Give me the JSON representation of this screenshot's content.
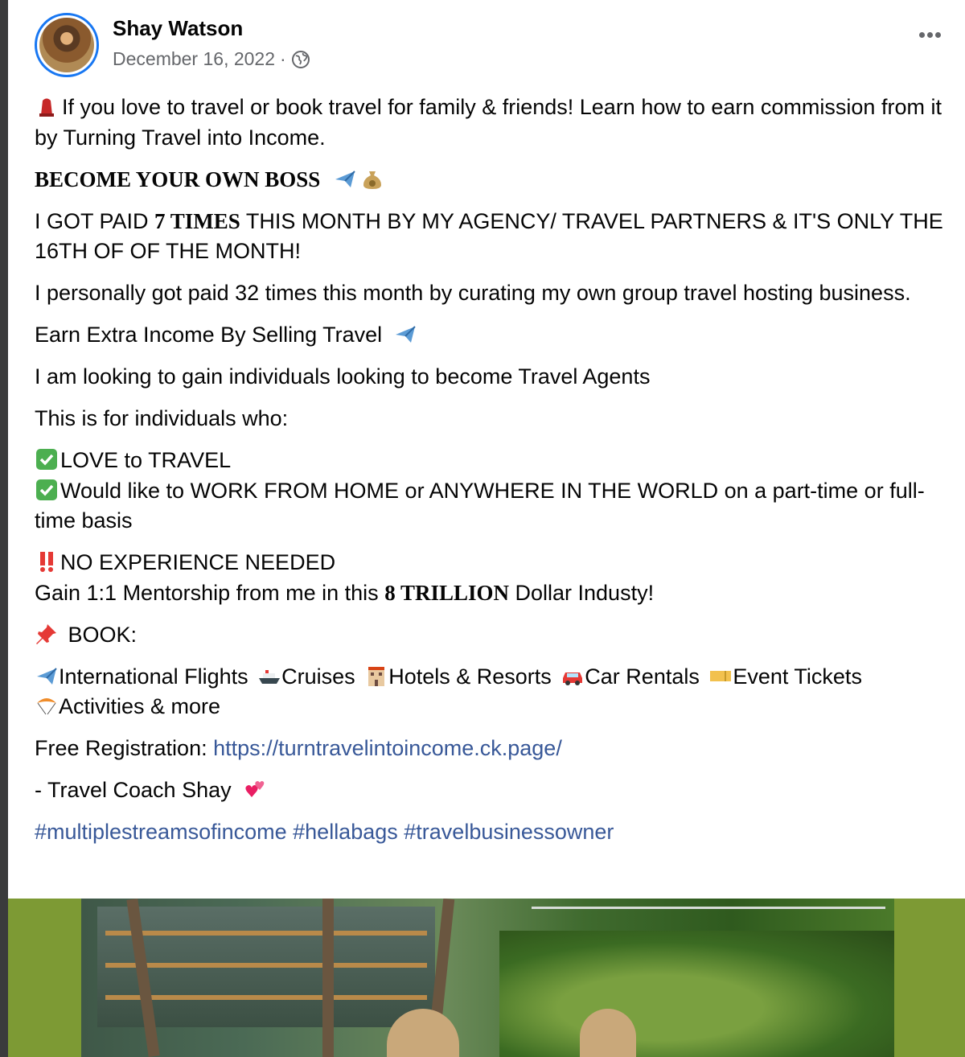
{
  "post": {
    "author": "Shay Watson",
    "date": "December 16, 2022",
    "separator": "·",
    "privacy_icon": "globe-icon",
    "menu_icon": "more-options-icon"
  },
  "content": {
    "p1_text": "If you love to travel or book travel for family & friends! Learn how to earn commission from it by Turning Travel into Income.",
    "p1_emoji": "red-hat-icon",
    "heading": "BECOME YOUR OWN BOSS",
    "heading_emojis": [
      "airplane-icon",
      "money-bag-icon"
    ],
    "p3_a": "I GOT PAID ",
    "p3_bold": "7 TIMES",
    "p3_b": " THIS MONTH BY MY AGENCY/ TRAVEL PARTNERS & IT'S ONLY THE 16TH OF OF THE MONTH!",
    "p4": "I personally got paid 32 times this month by curating my own group travel hosting business.",
    "p5": "Earn Extra Income By Selling Travel",
    "p6": "I am looking to gain individuals looking to become Travel Agents",
    "p7": "This is for individuals who:",
    "check1": "LOVE to TRAVEL",
    "check2": "Would like to WORK FROM HOME or ANYWHERE IN THE WORLD on a part-time or full-time basis",
    "no_exp": "NO EXPERIENCE NEEDED",
    "mentor_a": "Gain 1:1 Mentorship from me in this ",
    "mentor_bold": "8 TRILLION",
    "mentor_b": " Dollar Industy!",
    "book": " BOOK:",
    "services": [
      "International Flights",
      "Cruises",
      "Hotels & Resorts",
      "Car Rentals",
      "Event Tickets",
      "Activities & more"
    ],
    "reg_label": "Free Registration: ",
    "reg_link": "https://turntravelintoincome.ck.page/",
    "signoff": "- Travel Coach Shay",
    "hashtags": [
      "#multiplestreamsofincome",
      "#hellabags",
      "#travelbusinessowner"
    ]
  },
  "colors": {
    "link": "#385898",
    "secondary_text": "#65676b",
    "photo_bg": "#7d9a34"
  }
}
